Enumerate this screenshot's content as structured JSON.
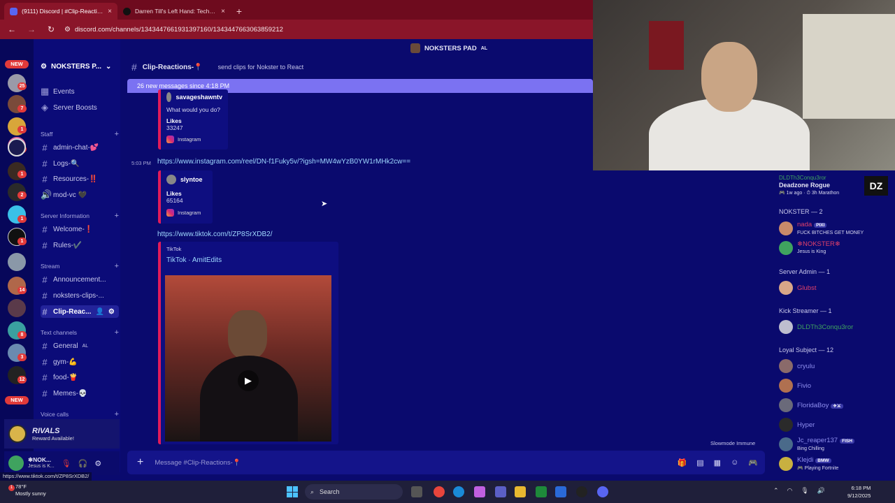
{
  "browser": {
    "tabs": [
      {
        "label": "(9111) Discord | #Clip-Reactions",
        "close": "×"
      },
      {
        "label": "Darren Till's Left Hand: Technique",
        "close": "×"
      }
    ],
    "new_tab": "+",
    "url": "discord.com/channels/1343447661931397160/1343447663063859212"
  },
  "guilds": {
    "badges": [
      "25",
      "7",
      "1",
      "1",
      "1",
      "2",
      "1",
      "1",
      "1",
      "14",
      "1",
      "8",
      "3",
      "12"
    ],
    "new_label": "NEW"
  },
  "server": {
    "name": "NOKSTERS P...",
    "top_name": "NOKSTERS PAD",
    "top_tag": "AL"
  },
  "sidebar": {
    "events": "Events",
    "boosts": "Server Boosts",
    "categories": {
      "staff": "Staff",
      "info": "Server Information",
      "stream": "Stream",
      "text": "Text channels",
      "voice": "Voice calls"
    },
    "channels": {
      "admin_chat": "admin-chat-💕",
      "logs": "Logs-🔍",
      "resources": "Resources-‼️",
      "mod_vc": "mod-vc 🖤",
      "welcome": "Welcome-❗",
      "rules": "Rules-✔️",
      "announcements": "Announcement...",
      "clips": "noksters-clips-...",
      "clip_react": "Clip-Reac...",
      "general": "General",
      "general_tag": "AL",
      "gym": "gym-💪",
      "food": "food-🍟",
      "memes": "Memes-💀"
    }
  },
  "promo": {
    "title": "RIVALS",
    "sub": "Reward Available!"
  },
  "user": {
    "name": "❄NOK...",
    "status": "Jesus is K..."
  },
  "chat": {
    "channel": "Clip-Reactions-📍",
    "topic": "send clips for Nokster to React",
    "new_messages": "26 new messages since 4:18 PM",
    "embed1": {
      "author": "savageshawntv",
      "text": "What would you do?",
      "likes_label": "Likes",
      "likes": "33247",
      "source": "Instagram"
    },
    "msg2": {
      "time": "5:03 PM",
      "link": "https://www.instagram.com/reel/DN-f1Fuky5v/?igsh=MW4wYzB0YW1rMHk2cw=="
    },
    "embed2": {
      "author": "slyntoe",
      "likes_label": "Likes",
      "likes": "65164",
      "source": "Instagram"
    },
    "msg3": {
      "link": "https://www.tiktok.com/t/ZP8SrXDB2/"
    },
    "embed3": {
      "provider": "TikTok",
      "title": "TikTok · AmitEdits"
    },
    "composer_placeholder": "Message #Clip-Reactions-📍",
    "slowmode": "Slowmode Immune"
  },
  "members": {
    "top_user": "DLDTh3Conqu3ror",
    "game": "Deadzone Rogue",
    "game_meta": "🎮 1w ago · ⏱ 3h Marathon",
    "groups": [
      {
        "label": "NOKSTER — 2"
      },
      {
        "label": "Server Admin — 1"
      },
      {
        "label": "Kick Streamer — 1"
      },
      {
        "label": "Loyal Subject — 12"
      }
    ],
    "nokster": [
      {
        "name": "nada",
        "tag": "PIXI",
        "sub": "FUCK BITCHES GET MONEY",
        "color": "#e0406a"
      },
      {
        "name": "❄NOKSTER❄",
        "sub": "Jesus is King",
        "color": "#e0406a"
      }
    ],
    "admin": {
      "name": "Glubst",
      "color": "#e0406a"
    },
    "kick": {
      "name": "DLDTh3Conqu3ror",
      "color": "#3fa35f"
    },
    "loyal": [
      {
        "name": "cryulu"
      },
      {
        "name": "Fivio"
      },
      {
        "name": "FloridaBoy",
        "tag": "✈⚔"
      },
      {
        "name": "Hyper"
      },
      {
        "name": "Jc_reaper137",
        "tag": "FISH",
        "sub": "Bing Chilling"
      },
      {
        "name": "Klejdi",
        "tag": "BMW",
        "sub": "🎮 Playing Fortnite"
      }
    ],
    "loyal_color": "#8f8ff0"
  },
  "status_url": "https://www.tiktok.com/t/ZP8SrXDB2/",
  "taskbar": {
    "temp": "78°F",
    "weather": "Mostly sunny",
    "weather_badge": "1",
    "search": "Search",
    "time": "6:18 PM",
    "date": "9/12/2025"
  }
}
